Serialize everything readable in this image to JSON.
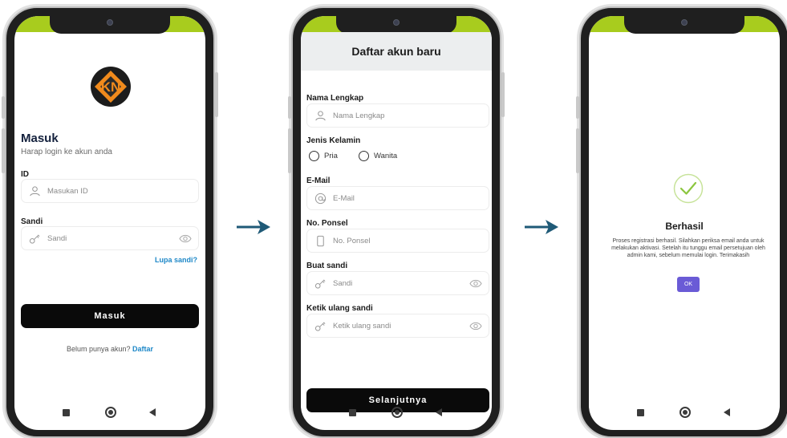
{
  "screen1": {
    "logo_text": "KN",
    "title": "Masuk",
    "subtitle": "Harap login ke akun anda",
    "id_label": "ID",
    "id_placeholder": "Masukan ID",
    "password_label": "Sandi",
    "password_placeholder": "Sandi",
    "forgot_link": "Lupa sandi?",
    "login_button": "Masuk",
    "no_account_text": "Belum punya akun?",
    "register_link": "Daftar"
  },
  "screen2": {
    "header_title": "Daftar akun baru",
    "fullname_label": "Nama Lengkap",
    "fullname_placeholder": "Nama Lengkap",
    "gender_label": "Jenis Kelamin",
    "gender_options": [
      "Pria",
      "Wanita"
    ],
    "email_label": "E-Mail",
    "email_placeholder": "E-Mail",
    "phone_label": "No. Ponsel",
    "phone_placeholder": "No. Ponsel",
    "password_label": "Buat sandi",
    "password_placeholder": "Sandi",
    "confirm_label": "Ketik ulang sandi",
    "confirm_placeholder": "Ketik ulang sandi",
    "next_button": "Selanjutnya"
  },
  "screen3": {
    "title": "Berhasil",
    "message": "Proses registrasi berhasil. Silahkan periksa email anda untuk melakukan aktivasi. Setelah itu tunggu email persetujuan oleh admin kami, sebelum memulai login. Terimakasih",
    "ok_button": "OK"
  },
  "colors": {
    "accent_bar": "#a8cc1e",
    "arrow": "#1f5a77",
    "link": "#1e88c8",
    "ok_button": "#6a5bd6",
    "success_check": "#8cc63f",
    "logo_orange": "#f08a1c"
  },
  "icons": [
    "user-icon",
    "key-icon",
    "eye-icon",
    "at-icon",
    "phone-icon",
    "check-icon",
    "arrow-right-icon",
    "home-icon",
    "back-icon",
    "recents-icon"
  ]
}
